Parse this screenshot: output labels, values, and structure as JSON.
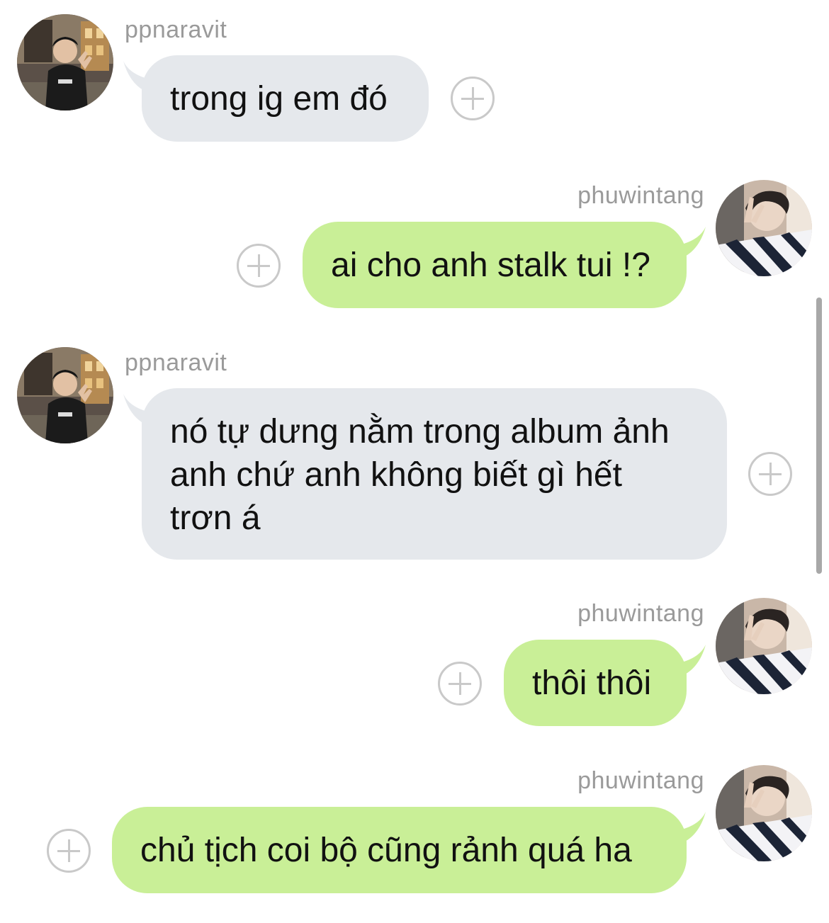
{
  "messages": [
    {
      "sender": "ppnaravit",
      "direction": "incoming",
      "text": "trong ig em đó"
    },
    {
      "sender": "phuwintang",
      "direction": "outgoing",
      "text": "ai cho anh stalk tui !?"
    },
    {
      "sender": "ppnaravit",
      "direction": "incoming",
      "text": "nó tự dưng nằm trong album ảnh\nanh chứ anh không biết gì hết\ntrơn á"
    },
    {
      "sender": "phuwintang",
      "direction": "outgoing",
      "text": "thôi thôi"
    },
    {
      "sender": "phuwintang",
      "direction": "outgoing",
      "text": "chủ tịch coi bộ cũng rảnh quá ha"
    }
  ],
  "colors": {
    "incoming_bubble": "#e5e8ec",
    "outgoing_bubble": "#c9ef97",
    "sender_name": "#9a9a9a",
    "add_button": "#c9c9c9"
  },
  "icons": {
    "add_reaction": "plus-circle-icon"
  }
}
